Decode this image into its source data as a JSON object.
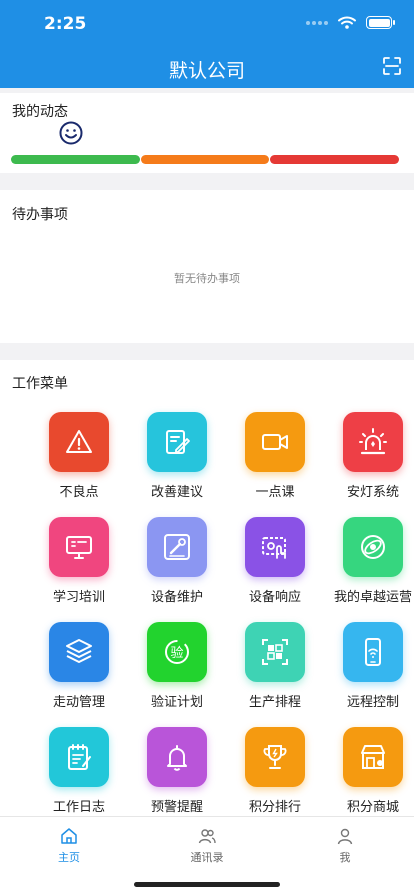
{
  "status": {
    "time": "2:25"
  },
  "header": {
    "title": "默认公司",
    "scan_icon": "scan-icon"
  },
  "dynamics": {
    "title": "我的动态",
    "mood_icon": "smile-icon",
    "bar_colors": [
      "#3dba4e",
      "#f57b1a",
      "#e53935"
    ]
  },
  "todo": {
    "title": "待办事项",
    "empty_text": "暂无待办事项"
  },
  "menu": {
    "title": "工作菜单",
    "items": [
      {
        "label": "不良点",
        "icon": "warning-icon",
        "color": "#e8492e"
      },
      {
        "label": "改善建议",
        "icon": "edit-note-icon",
        "color": "#26c4dc"
      },
      {
        "label": "一点课",
        "icon": "video-icon",
        "color": "#f59a10"
      },
      {
        "label": "安灯系统",
        "icon": "alarm-light-icon",
        "color": "#ee3f46"
      },
      {
        "label": "学习培训",
        "icon": "monitor-icon",
        "color": "#f0467f"
      },
      {
        "label": "设备维护",
        "icon": "wrench-icon",
        "color": "#8b96f2"
      },
      {
        "label": "设备响应",
        "icon": "touch-device-icon",
        "color": "#8a52e6"
      },
      {
        "label": "我的卓越运营",
        "icon": "orbit-icon",
        "color": "#36d67f"
      },
      {
        "label": "走动管理",
        "icon": "layers-icon",
        "color": "#2a86e6"
      },
      {
        "label": "验证计划",
        "icon": "verify-icon",
        "color": "#22d32e"
      },
      {
        "label": "生产排程",
        "icon": "schedule-scan-icon",
        "color": "#3ed3b4"
      },
      {
        "label": "远程控制",
        "icon": "phone-wifi-icon",
        "color": "#36b6ef"
      },
      {
        "label": "工作日志",
        "icon": "log-icon",
        "color": "#22c7d9"
      },
      {
        "label": "预警提醒",
        "icon": "bell-icon",
        "color": "#b955d9"
      },
      {
        "label": "积分排行",
        "icon": "trophy-icon",
        "color": "#f59a10"
      },
      {
        "label": "积分商城",
        "icon": "shop-icon",
        "color": "#f59a10"
      }
    ]
  },
  "tabbar": {
    "items": [
      {
        "label": "主页",
        "icon": "home-icon",
        "active": true
      },
      {
        "label": "通讯录",
        "icon": "contacts-icon",
        "active": false
      },
      {
        "label": "我",
        "icon": "profile-icon",
        "active": false
      }
    ],
    "active_color": "#1f8fe5"
  }
}
